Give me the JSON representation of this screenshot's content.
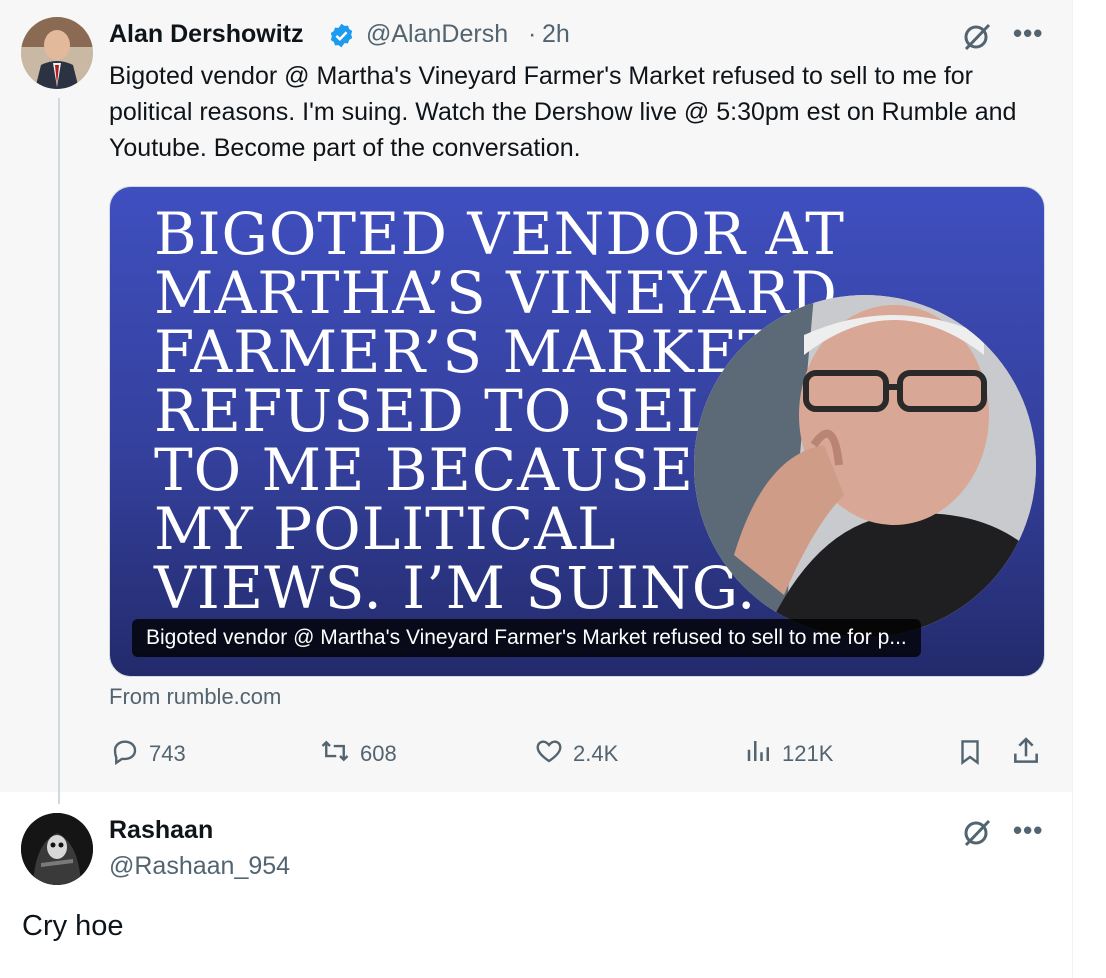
{
  "tweet": {
    "author_name": "Alan Dershowitz",
    "handle": "@AlanDersh",
    "separator": "·",
    "time": "2h",
    "text": "Bigoted vendor @ Martha's Vineyard Farmer's Market refused to sell to me for political reasons. I'm suing. Watch the Dershow live @ 5:30pm est on Rumble and Youtube. Become part of the conversation.",
    "card": {
      "image_text": "BIGOTED VENDOR AT\nMARTHA’S VINEYARD\nFARMER’S MARKET\nREFUSED TO SELL\nTO ME BECAUSE OF\nMY POLITICAL\nVIEWS. I’M SUING.",
      "caption": "Bigoted vendor @ Martha's Vineyard Farmer's Market refused to sell to me for p...",
      "source": "From rumble.com"
    },
    "actions": {
      "replies": "743",
      "reposts": "608",
      "likes": "2.4K",
      "views": "121K"
    }
  },
  "reply": {
    "author_name": "Rashaan",
    "handle": "@Rashaan_954",
    "text": "Cry hoe"
  },
  "icons": {
    "verified": "verified-badge-icon",
    "grok": "grok-icon",
    "more": "more-icon",
    "reply": "reply-icon",
    "repost": "repost-icon",
    "like": "like-icon",
    "views": "views-icon",
    "bookmark": "bookmark-icon",
    "share": "share-icon"
  },
  "colors": {
    "verified": "#1d9bf0",
    "secondary_text": "#536471",
    "card_blue": "#3a47b0"
  }
}
